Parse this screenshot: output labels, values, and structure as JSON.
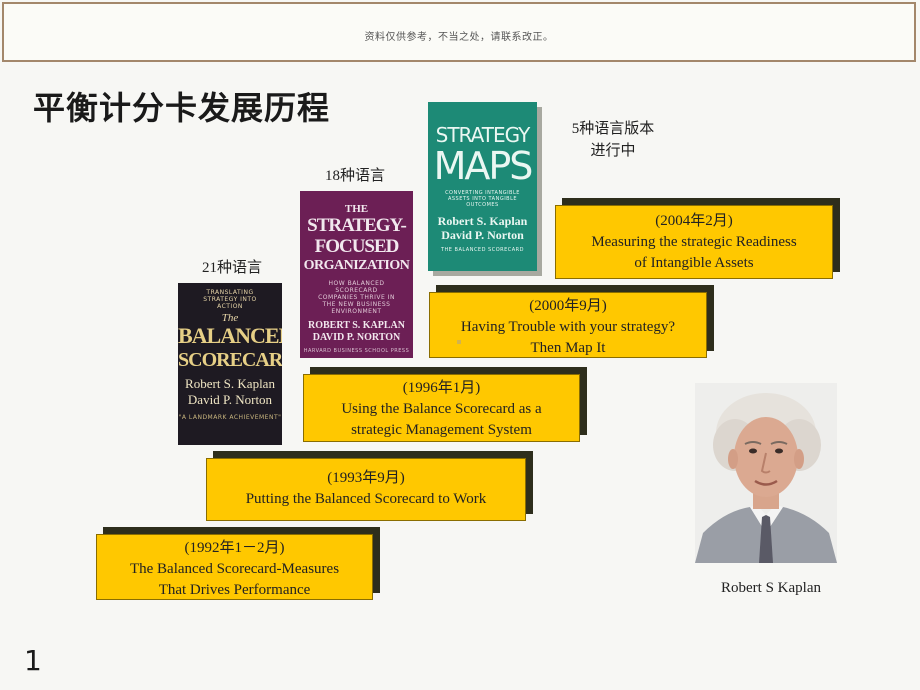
{
  "header": {
    "notice": "资料仅供参考，不当之处，请联系改正。"
  },
  "slide": {
    "title": "平衡计分卡发展历程",
    "page_number": "1"
  },
  "language_labels": {
    "bsc": "21种语言",
    "sfo": "18种语言",
    "maps_line1": "5种语言版本",
    "maps_line2": "进行中"
  },
  "books": {
    "bsc": {
      "top_text": "TRANSLATING STRATEGY INTO ACTION",
      "the": "The",
      "title_line1": "BALANCED",
      "title_line2": "SCORECARD",
      "author1": "Robert S. Kaplan",
      "author2": "David P. Norton",
      "footer": "\"A LANDMARK ACHIEVEMENT\""
    },
    "sfo": {
      "the": "THE",
      "title_line1": "STRATEGY-",
      "title_line2": "FOCUSED",
      "title_line3": "ORGANIZATION",
      "subtitle": "HOW BALANCED SCORECARD COMPANIES THRIVE IN THE NEW BUSINESS ENVIRONMENT",
      "author1": "ROBERT S. KAPLAN",
      "author2": "DAVID P. NORTON",
      "footer": "HARVARD BUSINESS SCHOOL PRESS"
    },
    "maps": {
      "title_line1": "STRATEGY",
      "title_line2": "MAPS",
      "subtitle": "CONVERTING INTANGIBLE ASSETS INTO TANGIBLE OUTCOMES",
      "author1": "Robert S. Kaplan",
      "author2": "David P. Norton",
      "footer": "THE BALANCED SCORECARD"
    }
  },
  "timeline": [
    {
      "date": "(1992年1－2月)",
      "line1": "The Balanced Scorecard-Measures",
      "line2": "That Drives Performance"
    },
    {
      "date": "(1993年9月)",
      "line1": "Putting the Balanced Scorecard to Work",
      "line2": ""
    },
    {
      "date": "(1996年1月)",
      "line1": "Using the Balance Scorecard as a",
      "line2": "strategic Management System"
    },
    {
      "date": "(2000年9月)",
      "line1": "Having Trouble with your strategy?",
      "line2": "Then Map It"
    },
    {
      "date": "(2004年2月)",
      "line1": "Measuring the strategic Readiness",
      "line2": "of Intangible Assets"
    }
  ],
  "photo": {
    "caption": "Robert S Kaplan"
  },
  "colors": {
    "box_fill": "#ffc800",
    "box_shadow": "#2e2e1c",
    "notice_border": "#a3876b"
  }
}
